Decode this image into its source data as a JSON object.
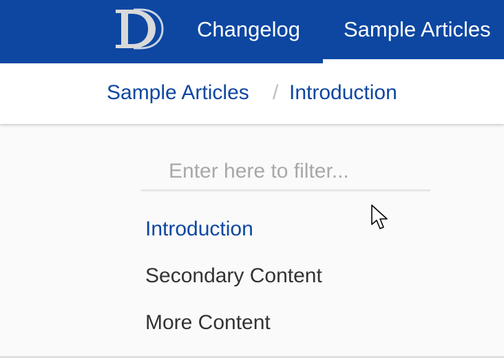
{
  "colors": {
    "primary": "#0d47a1",
    "nav_text": "#ffffff",
    "link_active": "#0d47a1",
    "text": "#333333",
    "placeholder": "#a8a8a8",
    "separator": "#bdbdbd"
  },
  "header": {
    "logo_icon": "letter-d-logo-icon",
    "nav": [
      {
        "label": "Changelog"
      },
      {
        "label": "Sample Articles",
        "active": true
      }
    ]
  },
  "breadcrumb": {
    "items": [
      "Sample Articles",
      "Introduction"
    ],
    "separator": "/"
  },
  "filter": {
    "placeholder": "Enter here to filter...",
    "value": ""
  },
  "articles": [
    {
      "label": "Introduction",
      "active": true
    },
    {
      "label": "Secondary Content",
      "active": false
    },
    {
      "label": "More Content",
      "active": false
    }
  ],
  "cursor_icon": "mouse-pointer-icon"
}
